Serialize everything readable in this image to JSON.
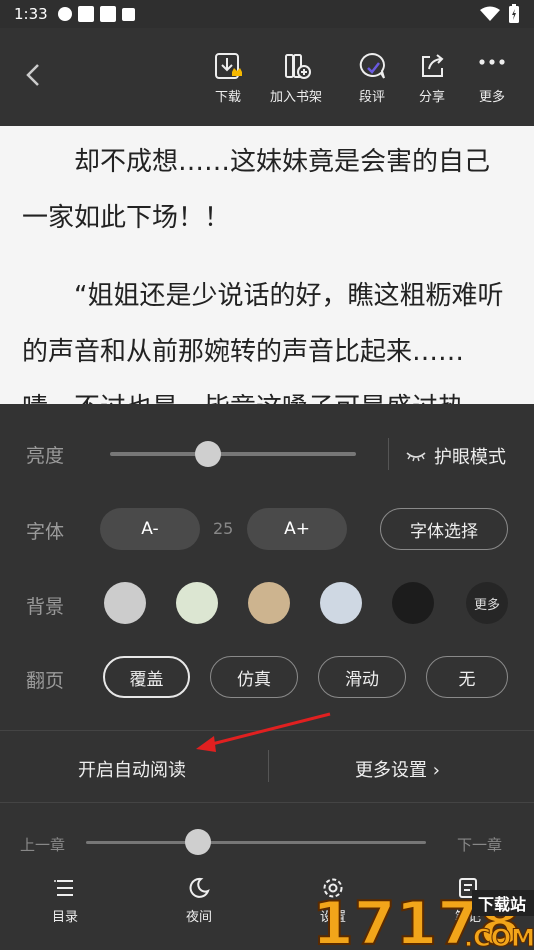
{
  "status": {
    "time": "1:33"
  },
  "toolbar": {
    "download": "下载",
    "add_shelf": "加入书架",
    "paragraph_comment": "段评",
    "share": "分享",
    "more": "更多"
  },
  "content": {
    "paragraphs": [
      "却不成想……这妹妹竟是会害的自己一家如此下场！！",
      "“姐姐还是少说话的好，瞧这粗粝难听的声音和从前那婉转的声音比起来……啧，不过也是，毕竟这嗓子可是盛过热"
    ]
  },
  "settings": {
    "brightness_label": "亮度",
    "brightness_level": 0.4,
    "eye_mode": "护眼模式",
    "font_label": "字体",
    "font_decrease": "A-",
    "font_size": "25",
    "font_increase": "A+",
    "font_select": "字体选择",
    "background_label": "背景",
    "background_colors": [
      "#cccccc",
      "#dce6d2",
      "#cdb48f",
      "#cfd8e3",
      "#1c1c1c"
    ],
    "background_more": "更多",
    "page_turn_label": "翻页",
    "page_turn_options": [
      "覆盖",
      "仿真",
      "滑动",
      "无"
    ],
    "page_turn_selected": "覆盖",
    "auto_read": "开启自动阅读",
    "more_settings": "更多设置 ›"
  },
  "chapter": {
    "prev": "上一章",
    "next": "下一章",
    "progress": 0.33
  },
  "bottom_nav": {
    "catalog": "目录",
    "night": "夜间",
    "settings": "设置",
    "notes": "笔记"
  },
  "watermark": {
    "text": "17178",
    "sub": "下载站",
    "suffix": ".COM"
  },
  "colors": {
    "annotation_arrow": "#e02020"
  }
}
